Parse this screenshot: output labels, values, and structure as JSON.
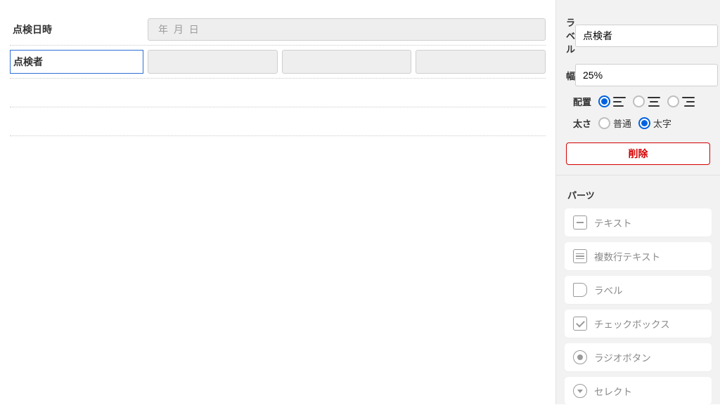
{
  "canvas": {
    "rows": [
      {
        "label": "点検日時",
        "placeholder": "年  月  日",
        "selected": false,
        "cells": 1
      },
      {
        "label": "点検者",
        "placeholder": "",
        "selected": true,
        "cells": 3
      }
    ]
  },
  "props": {
    "label_field_label": "ラベル",
    "label_value": "点検者",
    "width_field_label": "幅",
    "width_value": "25%",
    "align_field_label": "配置",
    "align_selected": "left",
    "weight_field_label": "太さ",
    "weight_options": {
      "normal": "普通",
      "bold": "太字"
    },
    "weight_selected": "bold",
    "delete_label": "削除"
  },
  "parts": {
    "title": "パーツ",
    "items": [
      {
        "icon": "text",
        "label": "テキスト"
      },
      {
        "icon": "multiline",
        "label": "複数行テキスト"
      },
      {
        "icon": "label",
        "label": "ラベル"
      },
      {
        "icon": "check",
        "label": "チェックボックス"
      },
      {
        "icon": "radio",
        "label": "ラジオボタン"
      },
      {
        "icon": "select",
        "label": "セレクト"
      }
    ]
  }
}
